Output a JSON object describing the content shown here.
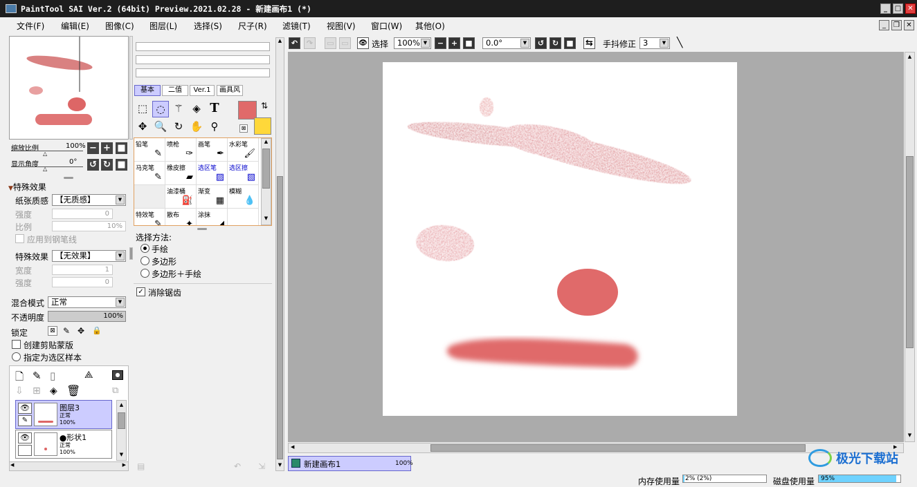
{
  "window": {
    "title": "PaintTool SAI Ver.2 (64bit) Preview.2021.02.28 - 新建画布1 (*)",
    "min": "_",
    "max": "□",
    "close": "✕"
  },
  "menu": [
    "文件(F)",
    "编辑(E)",
    "图像(C)",
    "图层(L)",
    "选择(S)",
    "尺子(R)",
    "滤镜(T)",
    "视图(V)",
    "窗口(W)",
    "其他(O)"
  ],
  "mdi": {
    "min": "_",
    "restore": "❐",
    "close": "✕"
  },
  "navigator": {
    "zoom_label": "缩放比例",
    "zoom_value": "100%",
    "angle_label": "显示角度",
    "angle_value": "0°"
  },
  "effects": {
    "header": "特殊效果",
    "paper_label": "纸张质感",
    "paper_value": "【无质感】",
    "strength_label": "强度",
    "strength_value": "0",
    "scale_label": "比例",
    "scale_value": "10%",
    "apply_label": "应用到钢笔线",
    "effect_label": "特殊效果",
    "effect_value": "【无效果】",
    "width_label": "宽度",
    "width_value": "1",
    "strength2_label": "强度",
    "strength2_value": "0"
  },
  "blend": {
    "mode_label": "混合模式",
    "mode_value": "正常",
    "opacity_label": "不透明度",
    "opacity_value": "100%",
    "opacity_level": 1.0,
    "lock_label": "锁定",
    "clip_label": "创建剪贴蒙版",
    "sample_label": "指定为选区样本"
  },
  "layers": [
    {
      "name": "图层3",
      "mode": "正常",
      "opacity": "100%",
      "selected": true
    },
    {
      "name": "形状1",
      "mode": "正常",
      "opacity": "100%",
      "selected": false
    }
  ],
  "tool_tabs": [
    "基本",
    "二值",
    "Ver.1",
    "画具风"
  ],
  "brushes": [
    {
      "name": "铅笔",
      "icon": "✎",
      "blue": false
    },
    {
      "name": "喷枪",
      "icon": "✑",
      "blue": false
    },
    {
      "name": "画笔",
      "icon": "✒",
      "blue": false
    },
    {
      "name": "水彩笔",
      "icon": "🖌",
      "blue": false
    },
    {
      "name": "马克笔",
      "icon": "✎",
      "blue": false
    },
    {
      "name": "橡皮擦",
      "icon": "▰",
      "blue": false
    },
    {
      "name": "选区笔",
      "icon": "▨",
      "blue": true
    },
    {
      "name": "选区擦",
      "icon": "▧",
      "blue": true
    },
    {
      "name": "",
      "icon": "",
      "blue": false
    },
    {
      "name": "油漆桶",
      "icon": "⛽",
      "blue": false
    },
    {
      "name": "渐变",
      "icon": "▦",
      "blue": false
    },
    {
      "name": "模糊",
      "icon": "💧",
      "blue": false
    },
    {
      "name": "特效笔",
      "icon": "✎",
      "blue": false
    },
    {
      "name": "散布",
      "icon": "✦",
      "blue": false
    },
    {
      "name": "涂抹",
      "icon": "◢",
      "blue": false
    },
    {
      "name": "",
      "icon": "",
      "blue": false
    }
  ],
  "selection": {
    "method_label": "选择方法:",
    "options": [
      "手绘",
      "多边形",
      "多边形＋手绘"
    ],
    "selected": 0,
    "antialias_label": "消除锯齿"
  },
  "colors": {
    "primary": "#e06a6a",
    "secondary": "#ffd83a",
    "accent": "#ccccff",
    "canvas_bg": "#ababab"
  },
  "toolbar": {
    "select_label": "选择",
    "zoom": "100%",
    "angle": "0.0°",
    "stabilizer_label": "手抖修正",
    "stabilizer_value": "3"
  },
  "canvas_tab": {
    "name": "新建画布1",
    "zoom": "100%"
  },
  "status": {
    "mem_label": "内存使用量",
    "mem_value": "2% (2%)",
    "disk_label": "磁盘使用量",
    "disk_value": "95%"
  },
  "watermark": "极光下载站"
}
